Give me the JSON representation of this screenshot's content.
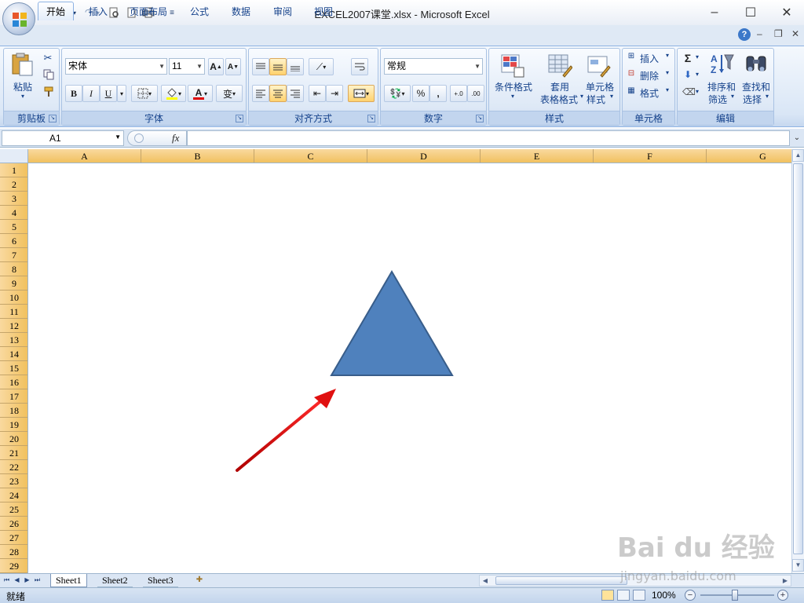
{
  "window": {
    "title": "EXCEL2007课堂.xlsx - Microsoft Excel",
    "controls": {
      "minimize": "–",
      "maximize": "☐",
      "close": "✕"
    }
  },
  "tabs": [
    {
      "label": "开始",
      "active": true
    },
    {
      "label": "插入"
    },
    {
      "label": "页面布局"
    },
    {
      "label": "公式"
    },
    {
      "label": "数据"
    },
    {
      "label": "审阅"
    },
    {
      "label": "视图"
    }
  ],
  "ribbon": {
    "clipboard": {
      "label": "剪贴板",
      "paste": "粘贴"
    },
    "font": {
      "label": "字体",
      "font_name": "宋体",
      "font_size": "11",
      "bold": "B",
      "italic": "I",
      "underline": "U",
      "font_color_glyph": "A",
      "grow_glyph": "A",
      "shrink_glyph": "A",
      "phonetic_glyph": "变"
    },
    "alignment": {
      "label": "对齐方式"
    },
    "number": {
      "label": "数字",
      "format": "常规",
      "percent": "%",
      "comma": ","
    },
    "styles": {
      "label": "样式",
      "conditional": "条件格式",
      "table_format_l1": "套用",
      "table_format_l2": "表格格式",
      "cell_styles_l1": "单元格",
      "cell_styles_l2": "样式"
    },
    "cells": {
      "label": "单元格",
      "insert": "插入",
      "delete": "删除",
      "format": "格式"
    },
    "editing": {
      "label": "编辑",
      "sum_glyph": "Σ",
      "sort_l1": "排序和",
      "sort_l2": "筛选",
      "find_l1": "查找和",
      "find_l2": "选择"
    }
  },
  "formula_bar": {
    "name_box": "A1",
    "fx": "fx",
    "value": ""
  },
  "columns": [
    "A",
    "B",
    "C",
    "D",
    "E",
    "F",
    "G"
  ],
  "rows": [
    "1",
    "2",
    "3",
    "4",
    "5",
    "6",
    "7",
    "8",
    "9",
    "10",
    "11",
    "12",
    "13",
    "14",
    "15",
    "16",
    "17",
    "18",
    "19",
    "20",
    "21",
    "22",
    "23",
    "24",
    "25",
    "26",
    "27",
    "28",
    "29"
  ],
  "sheet_tabs": [
    {
      "label": "Sheet1",
      "active": true
    },
    {
      "label": "Sheet2"
    },
    {
      "label": "Sheet3"
    }
  ],
  "status": {
    "ready": "就绪",
    "zoom": "100%"
  },
  "colors": {
    "triangle_fill": "#4f81bd",
    "triangle_stroke": "#385d8a",
    "arrow": "#e01010"
  },
  "watermark": {
    "brand": "Bai du 经验",
    "url": "jingyan.baidu.com"
  }
}
